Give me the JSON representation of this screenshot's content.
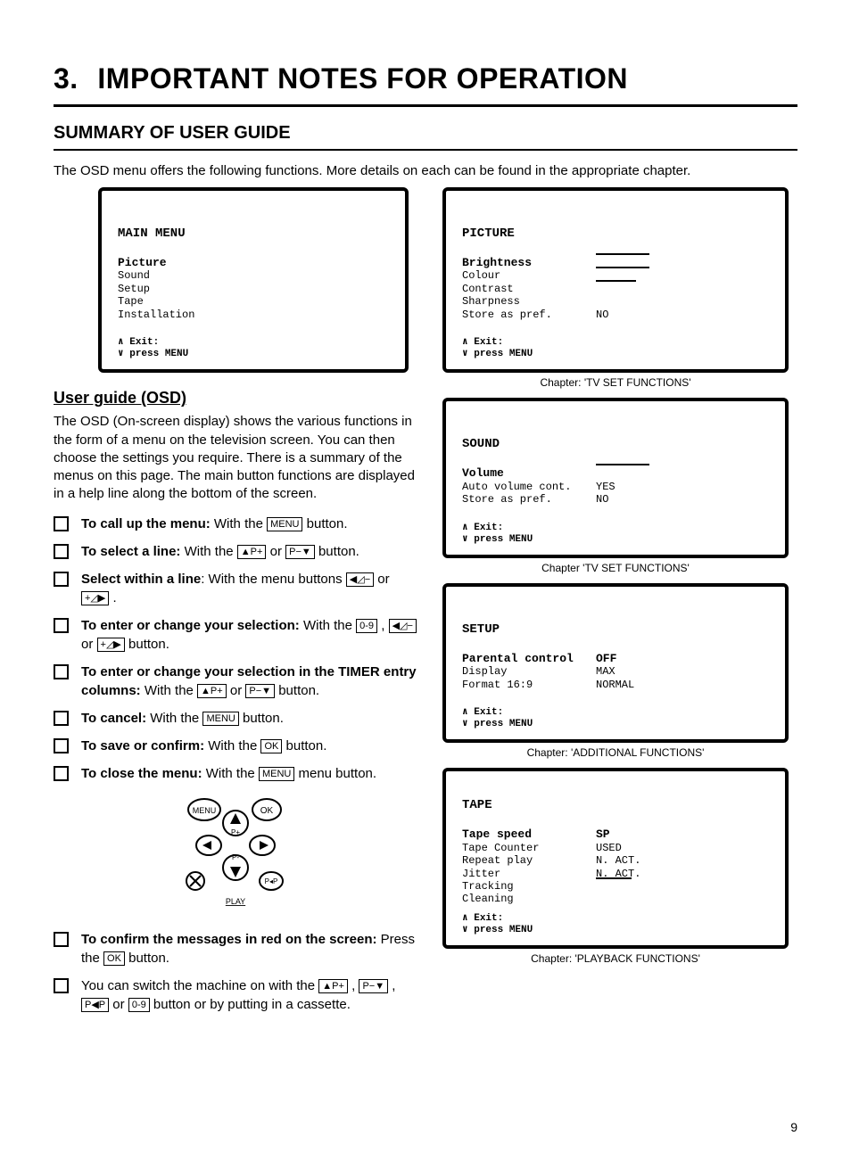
{
  "chapter": {
    "num": "3.",
    "title": "IMPORTANT NOTES FOR OPERATION"
  },
  "section_title": "SUMMARY OF USER GUIDE",
  "intro": "The OSD menu offers the following functions. More details on each can be found in the appropriate chapter.",
  "osd_main": {
    "title": "MAIN MENU",
    "highlight": "Picture",
    "items": [
      "Sound",
      "Setup",
      "Tape",
      "Installation"
    ],
    "exit1": "∧ Exit:",
    "exit2": "∨ press MENU"
  },
  "osd_picture": {
    "title": "PICTURE",
    "highlight": "Brightness",
    "rows": [
      {
        "lbl": "Colour",
        "val": ""
      },
      {
        "lbl": "Contrast",
        "val": ""
      },
      {
        "lbl": "Sharpness",
        "val": ""
      },
      {
        "lbl": "Store as pref.",
        "val": "NO"
      }
    ],
    "exit1": "∧ Exit:",
    "exit2": "∨ press MENU",
    "chapter": "Chapter: 'TV SET FUNCTIONS'"
  },
  "osd_sound": {
    "title": "SOUND",
    "highlight": "Volume",
    "rows": [
      {
        "lbl": "Auto volume cont.",
        "val": "YES"
      },
      {
        "lbl": "Store as pref.",
        "val": "NO"
      }
    ],
    "exit1": "∧ Exit:",
    "exit2": "∨ press MENU",
    "chapter": "Chapter 'TV SET FUNCTIONS'"
  },
  "osd_setup": {
    "title": "SETUP",
    "highlight": "Parental control",
    "highlight_val": "OFF",
    "rows": [
      {
        "lbl": "Display",
        "val": "MAX"
      },
      {
        "lbl": "Format 16:9",
        "val": "NORMAL"
      }
    ],
    "exit1": "∧ Exit:",
    "exit2": "∨ press MENU",
    "chapter": "Chapter: 'ADDITIONAL FUNCTIONS'"
  },
  "osd_tape": {
    "title": "TAPE",
    "highlight": "Tape speed",
    "highlight_val": "SP",
    "rows": [
      {
        "lbl": "Tape Counter",
        "val": "USED"
      },
      {
        "lbl": "Repeat play",
        "val": "N. ACT."
      },
      {
        "lbl": "Jitter",
        "val": "N. ACT."
      },
      {
        "lbl": "Tracking",
        "val": ""
      },
      {
        "lbl": "Cleaning",
        "val": ""
      }
    ],
    "exit1": "∧ Exit:",
    "exit2": "∨ press MENU",
    "chapter": "Chapter: 'PLAYBACK FUNCTIONS'"
  },
  "guide": {
    "title": "User guide (OSD)",
    "body": "The OSD (On-screen display) shows the various functions in the form of a menu on the television screen. You can then choose the settings you require. There is a summary of the menus on this page. The main button functions are displayed in a help line along the bottom of the screen."
  },
  "buttons": {
    "menu": "MENU",
    "p_plus": "▲P+",
    "p_minus": "P−▼",
    "left": "◀◿−",
    "right": "+◿▶",
    "digits": "0-9",
    "ok": "OK",
    "pswap": "P◀P"
  },
  "items": {
    "call_bold": "To call up the menu:",
    "call_rest": " With the ",
    "call_end": " button.",
    "select_bold": "To select a line:",
    "select_rest": " With the ",
    "select_or": " or ",
    "select_end": " button.",
    "within_bold": "Select within a line",
    "within_rest": ": With the menu buttons ",
    "within_or": " or ",
    "within_end": " .",
    "enter_bold": "To enter or change your selection:",
    "enter_rest": " With the ",
    "enter_or1": " , ",
    "enter_or2": " or ",
    "enter_end": " button.",
    "timer_bold": "To enter or change your selection in the TIMER entry columns:",
    "timer_rest": " With the ",
    "timer_or": " or ",
    "timer_end": " button.",
    "cancel_bold": "To cancel:",
    "cancel_rest": " With the ",
    "cancel_end": " button.",
    "save_bold": "To save or confirm:",
    "save_rest": " With the ",
    "save_end": " button.",
    "close_bold": "To close the menu:",
    "close_rest": " With the ",
    "close_end": " menu button.",
    "confirm_bold": "To confirm the messages in red on the screen:",
    "confirm_rest": " Press the ",
    "confirm_end": " button.",
    "switch": "You can switch the machine on with the ",
    "switch_sep1": " , ",
    "switch_sep2": " , ",
    "switch_or": " or ",
    "switch_end": " button or by putting in a cassette."
  },
  "remote_labels": {
    "menu": "MENU",
    "ok": "OK",
    "play": "PLAY",
    "pplus": "P+",
    "pminus": "P-"
  },
  "page": "9"
}
